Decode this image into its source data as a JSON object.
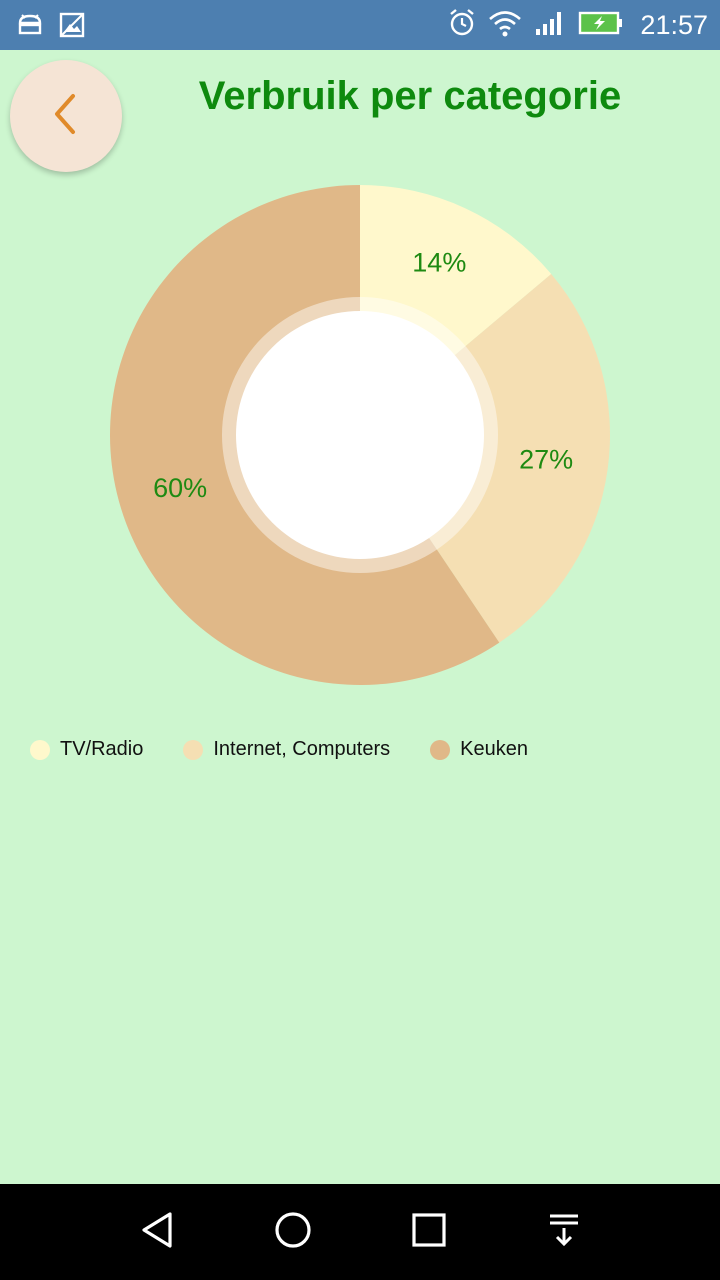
{
  "status_bar": {
    "time": "21:57",
    "icons": [
      "android-debug-icon",
      "image-icon",
      "alarm-icon",
      "wifi-icon",
      "signal-icon",
      "battery-charging-icon"
    ]
  },
  "header": {
    "title": "Verbruik per categorie",
    "back_icon": "chevron-left-icon"
  },
  "colors": {
    "background": "#cdf6cf",
    "title": "#0e8a0e",
    "label": "#1e8a12",
    "status_bar": "#4d7fb0"
  },
  "chart_data": {
    "type": "pie",
    "donut": true,
    "labels": [
      "TV/Radio",
      "Internet, Computers",
      "Keuken"
    ],
    "values": [
      14,
      27,
      60
    ],
    "value_labels": [
      "14%",
      "27%",
      "60%"
    ],
    "colors": [
      "#fff8cc",
      "#f5dfb3",
      "#e0b888"
    ],
    "legend_position": "bottom-left"
  },
  "nav_bar": {
    "buttons": [
      "back-triangle-icon",
      "home-circle-icon",
      "recents-square-icon",
      "notifications-down-icon"
    ]
  }
}
